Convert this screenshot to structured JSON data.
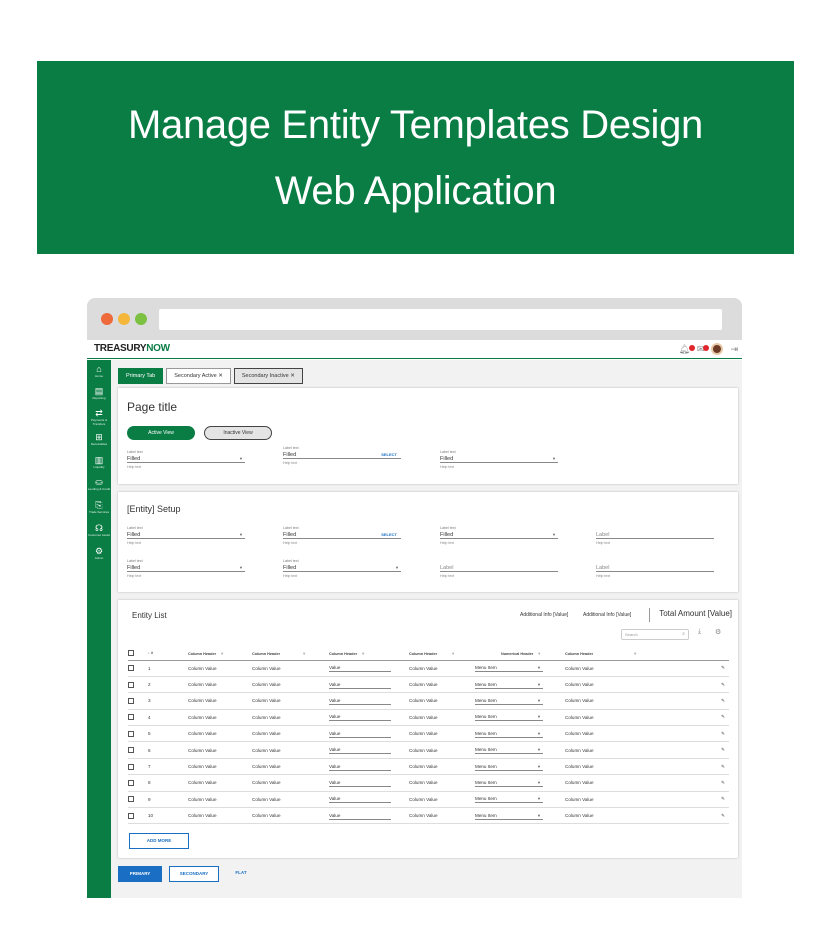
{
  "banner": {
    "line1": "Manage Entity Templates Design",
    "line2": "Web Application"
  },
  "app": {
    "logo_a": "TREASURY",
    "logo_b": "NOW"
  },
  "header": {
    "icons": [
      "bell-icon",
      "mail-icon",
      "avatar",
      "logout-icon"
    ]
  },
  "sidebar": {
    "items": [
      {
        "icon": "⌂",
        "label": "Home"
      },
      {
        "icon": "▤",
        "label": "Reporting"
      },
      {
        "icon": "⇄",
        "label": "Payments & Transfers"
      },
      {
        "icon": "⊞",
        "label": "Receivables"
      },
      {
        "icon": "▥",
        "label": "Liquidity"
      },
      {
        "icon": "⛀",
        "label": "Lending & Credit"
      },
      {
        "icon": "⎘",
        "label": "Trade Services"
      },
      {
        "icon": "☊",
        "label": "Customer Assist"
      },
      {
        "icon": "⚙",
        "label": "Admin"
      }
    ]
  },
  "tabs": {
    "primary": "Primary Tab",
    "secondary_active": "Secondary Active ✕",
    "secondary_inactive": "Secondary Inactive ✕"
  },
  "card1": {
    "title": "Page title",
    "active_view": "Active View",
    "inactive_view": "Inactive View",
    "fields": [
      {
        "label": "Label text",
        "value": "Filled",
        "help": "Help text",
        "kind": "dropdown"
      },
      {
        "label": "Label text",
        "value": "Filled",
        "help": "Help text",
        "kind": "select",
        "action": "SELECT"
      },
      {
        "label": "Label text",
        "value": "Filled",
        "help": "Help text",
        "kind": "dropdown"
      }
    ]
  },
  "card2": {
    "title": "[Entity] Setup",
    "row1": [
      {
        "label": "Label text",
        "value": "Filled",
        "help": "Help text",
        "kind": "dropdown"
      },
      {
        "label": "Label text",
        "value": "Filled",
        "help": "Help text",
        "kind": "select",
        "action": "SELECT"
      },
      {
        "label": "Label text",
        "value": "Filled",
        "help": "Help text",
        "kind": "dropdown"
      },
      {
        "label": "",
        "value": "Label",
        "help": "Help text",
        "kind": "label"
      }
    ],
    "row2": [
      {
        "label": "Label text",
        "value": "Filled",
        "help": "Help text",
        "kind": "dropdown"
      },
      {
        "label": "Label text",
        "value": "Filled",
        "help": "Help text",
        "kind": "dropdown"
      },
      {
        "label": "",
        "value": "Label",
        "help": "Help text",
        "kind": "label"
      },
      {
        "label": "",
        "value": "Label",
        "help": "Help text",
        "kind": "label"
      }
    ]
  },
  "entity_list": {
    "title": "Entity List",
    "info1": "Additional Info [Value]",
    "info2": "Additional Info [Value]",
    "total": "Total Amount [Value]",
    "search_placeholder": "Search",
    "columns": [
      "#",
      "Column Header",
      "Column Header",
      "Column Header",
      "Column Header",
      "Numerical Header",
      "Column Header"
    ],
    "rows": [
      {
        "n": "1",
        "c1": "Column Value",
        "c2": "Column Value",
        "v": "Value",
        "c4": "Column Value",
        "menu": "Menu Item",
        "c6": "Column Value"
      },
      {
        "n": "2",
        "c1": "Column Value",
        "c2": "Column Value",
        "v": "Value",
        "c4": "Column Value",
        "menu": "Menu Item",
        "c6": "Column Value"
      },
      {
        "n": "3",
        "c1": "Column Value",
        "c2": "Column Value",
        "v": "Value",
        "c4": "Column Value",
        "menu": "Menu Item",
        "c6": "Column Value"
      },
      {
        "n": "4",
        "c1": "Column Value",
        "c2": "Column Value",
        "v": "Value",
        "c4": "Column Value",
        "menu": "Menu Item",
        "c6": "Column Value"
      },
      {
        "n": "5",
        "c1": "Column Value",
        "c2": "Column Value",
        "v": "Value",
        "c4": "Column Value",
        "menu": "Menu Item",
        "c6": "Column Value"
      },
      {
        "n": "6",
        "c1": "Column Value",
        "c2": "Column Value",
        "v": "Value",
        "c4": "Column Value",
        "menu": "Menu Item",
        "c6": "Column Value"
      },
      {
        "n": "7",
        "c1": "Column Value",
        "c2": "Column Value",
        "v": "Value",
        "c4": "Column Value",
        "menu": "Menu Item",
        "c6": "Column Value"
      },
      {
        "n": "8",
        "c1": "Column Value",
        "c2": "Column Value",
        "v": "Value",
        "c4": "Column Value",
        "menu": "Menu Item",
        "c6": "Column Value"
      },
      {
        "n": "9",
        "c1": "Column Value",
        "c2": "Column Value",
        "v": "Value",
        "c4": "Column Value",
        "menu": "Menu Item",
        "c6": "Column Value"
      },
      {
        "n": "10",
        "c1": "Column Value",
        "c2": "Column Value",
        "v": "Value",
        "c4": "Column Value",
        "menu": "Menu Item",
        "c6": "Column Value"
      }
    ],
    "add_more": "ADD MORE"
  },
  "footer": {
    "primary": "PRIMARY",
    "secondary": "SECONDARY",
    "flat": "FLAT"
  },
  "colors": {
    "brand_green": "#0a7d45",
    "link_blue": "#1a6fc4",
    "badge_red": "#e0262c"
  }
}
